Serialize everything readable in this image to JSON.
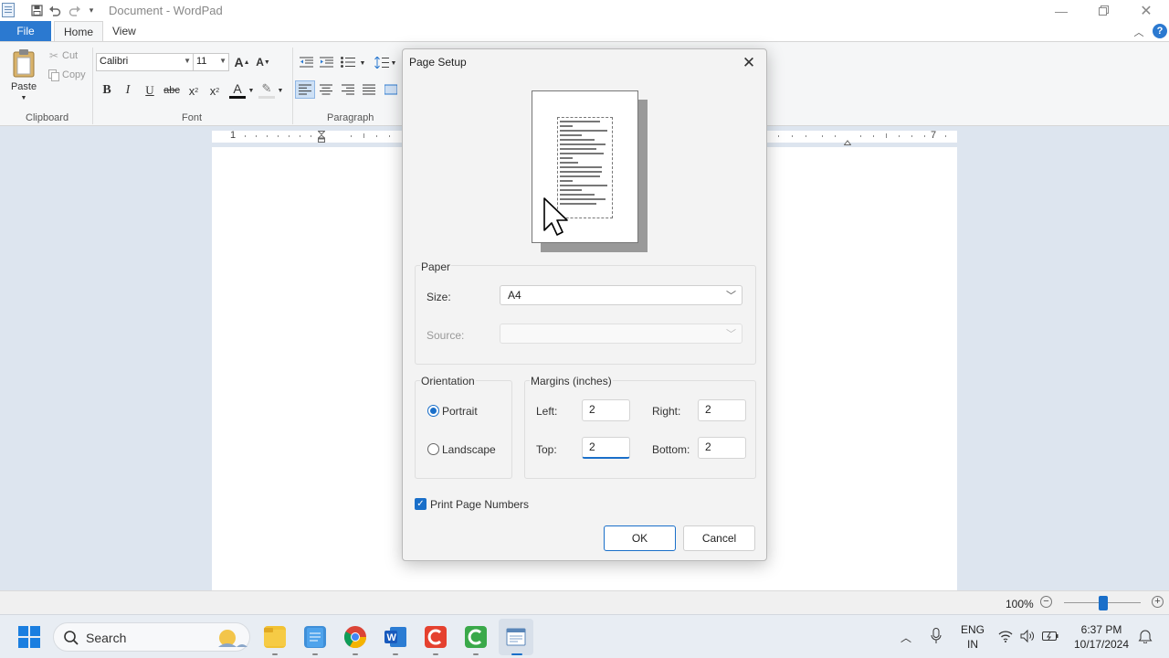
{
  "window": {
    "title": "Document - WordPad",
    "icons": [
      "save-icon",
      "undo-icon",
      "redo-icon",
      "customize-qat-icon"
    ],
    "controls": [
      "minimize-icon",
      "restore-icon",
      "close-icon"
    ]
  },
  "ribbon": {
    "tabs": [
      "File",
      "Home",
      "View"
    ],
    "clipboard": {
      "paste": "Paste",
      "cut": "Cut",
      "copy": "Copy",
      "label": "Clipboard"
    },
    "font": {
      "family": "Calibri",
      "size": "11",
      "label": "Font"
    },
    "paragraph": {
      "label": "Paragraph"
    },
    "help": "?"
  },
  "ruler": {
    "left_number": "1",
    "right_number": "7"
  },
  "dialog": {
    "title": "Page Setup",
    "paper": {
      "label": "Paper",
      "size_label": "Size:",
      "size_value": "A4",
      "source_label": "Source:",
      "source_value": ""
    },
    "orientation": {
      "label": "Orientation",
      "portrait": "Portrait",
      "landscape": "Landscape",
      "selected": "Portrait"
    },
    "margins": {
      "label": "Margins (inches)",
      "left_label": "Left:",
      "left": "2",
      "right_label": "Right:",
      "right": "2",
      "top_label": "Top:",
      "top": "2",
      "bottom_label": "Bottom:",
      "bottom": "2"
    },
    "print_page_numbers": {
      "label": "Print Page Numbers",
      "checked": true
    },
    "ok": "OK",
    "cancel": "Cancel"
  },
  "statusbar": {
    "zoom": "100%",
    "zoom_out": "−",
    "zoom_in": "+",
    "zoom_level": 1.0
  },
  "taskbar": {
    "search": "Search",
    "language": "ENG",
    "region": "IN",
    "time": "6:37 PM",
    "date": "10/17/2024",
    "colors": {
      "accent": "#1a6fc9",
      "file_tab": "#2b79d0"
    }
  }
}
